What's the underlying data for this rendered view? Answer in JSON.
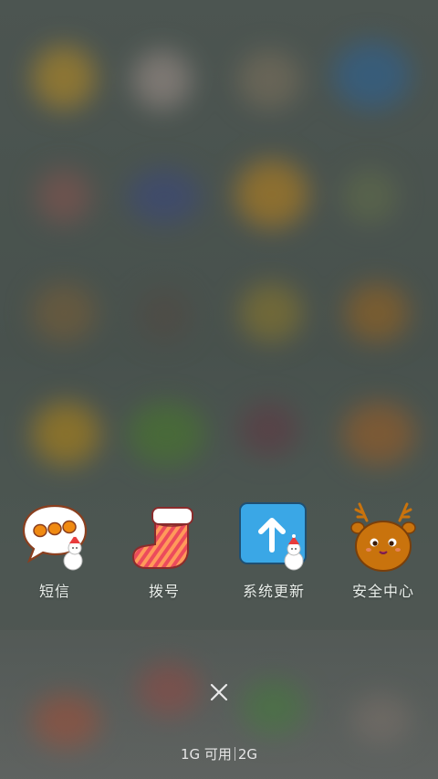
{
  "apps": [
    {
      "label": "短信",
      "icon": "sms-bubble-icon"
    },
    {
      "label": "拨号",
      "icon": "christmas-stocking-phone-icon"
    },
    {
      "label": "系统更新",
      "icon": "system-update-arrow-icon"
    },
    {
      "label": "安全中心",
      "icon": "reindeer-security-icon"
    }
  ],
  "memory": {
    "available": "1G 可用",
    "total": "2G"
  },
  "close_icon": "close-x-icon",
  "colors": {
    "accent_blue": "#3aa7e6",
    "stocking_red": "#e84a4a",
    "reindeer_brown": "#c9730d"
  }
}
